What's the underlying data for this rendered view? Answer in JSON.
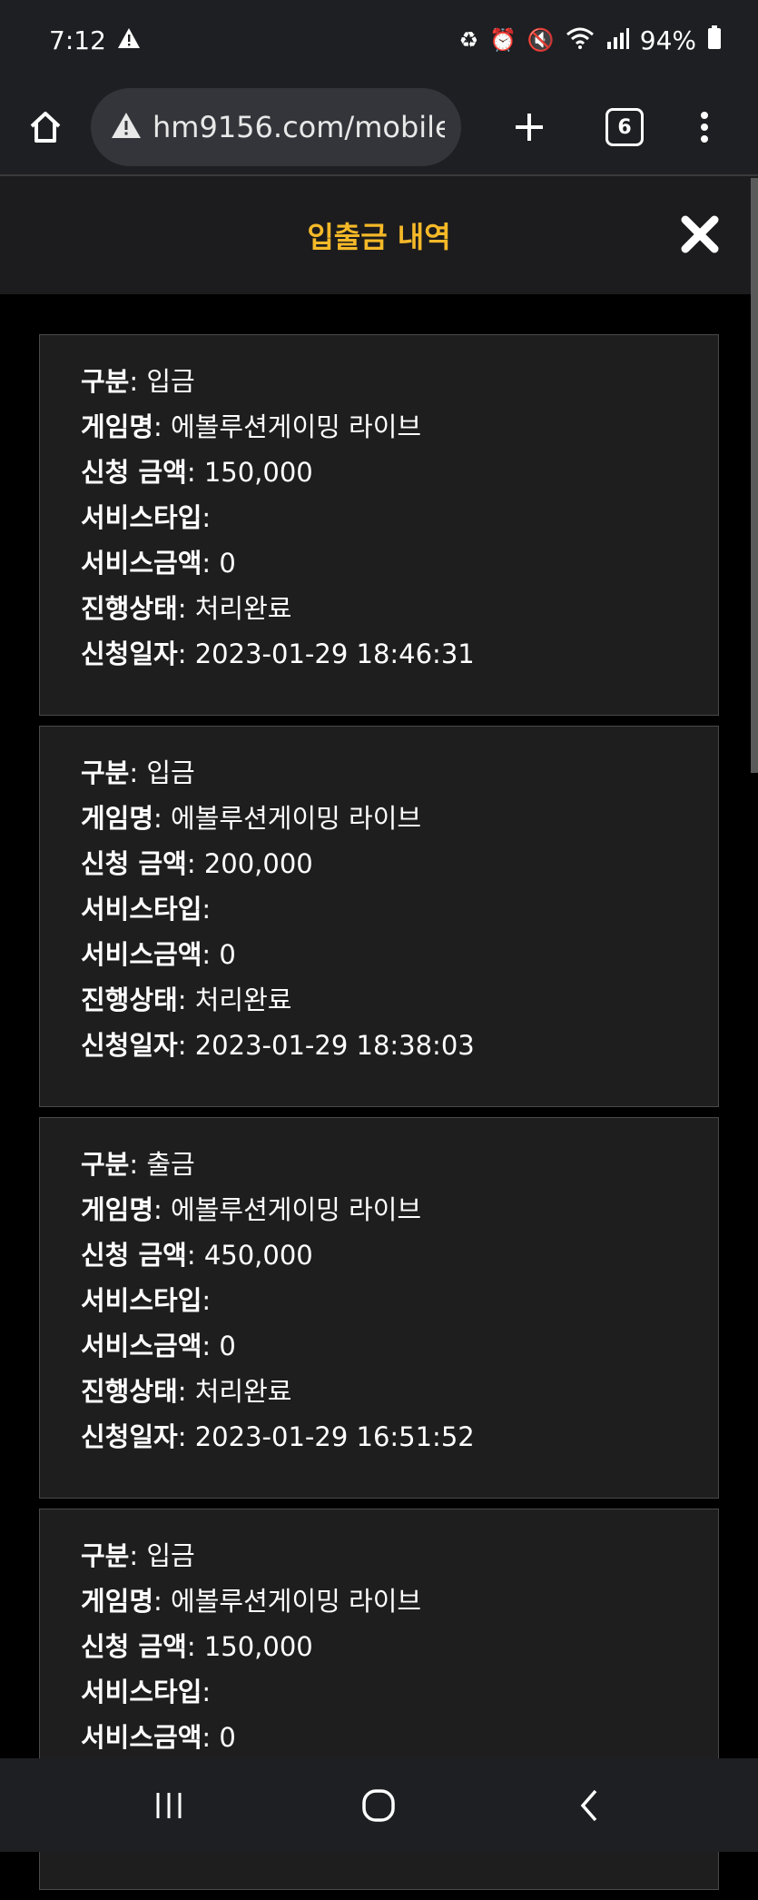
{
  "status": {
    "time": "7:12",
    "battery": "94%"
  },
  "browser": {
    "url": "hm9156.com/mobile",
    "tab_count": "6"
  },
  "dialog": {
    "title": "입출금 내역"
  },
  "labels": {
    "type": "구분",
    "game": "게임명",
    "amount": "신청 금액",
    "service_type": "서비스타입",
    "service_amount": "서비스금액",
    "status": "진행상태",
    "date": "신청일자"
  },
  "transactions": [
    {
      "type": "입금",
      "game": "에볼루션게이밍 라이브",
      "amount": "150,000",
      "service_type": "",
      "service_amount": "0",
      "status": "처리완료",
      "date": "2023-01-29 18:46:31"
    },
    {
      "type": "입금",
      "game": "에볼루션게이밍 라이브",
      "amount": "200,000",
      "service_type": "",
      "service_amount": "0",
      "status": "처리완료",
      "date": "2023-01-29 18:38:03"
    },
    {
      "type": "출금",
      "game": "에볼루션게이밍 라이브",
      "amount": "450,000",
      "service_type": "",
      "service_amount": "0",
      "status": "처리완료",
      "date": "2023-01-29 16:51:52"
    },
    {
      "type": "입금",
      "game": "에볼루션게이밍 라이브",
      "amount": "150,000",
      "service_type": "",
      "service_amount": "0"
    }
  ],
  "colors": {
    "accent": "#f5b928",
    "card_bg": "#1e1e1e",
    "card_border": "#4a4a4a"
  }
}
